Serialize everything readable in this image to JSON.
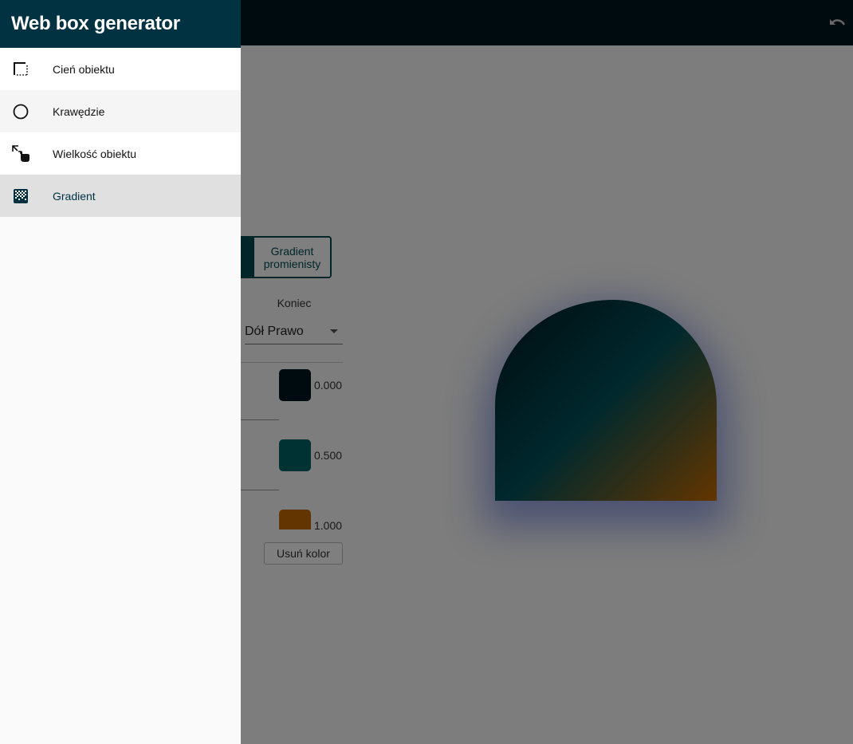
{
  "app": {
    "title": "Web box generator",
    "undo_icon": "undo-icon"
  },
  "nav": {
    "items": [
      {
        "label": "Cień obiektu",
        "icon": "box-shadow-icon",
        "bg": "#ffffff",
        "active": false
      },
      {
        "label": "Krawędzie",
        "icon": "circle-outline-icon",
        "bg": "#f5f5f5",
        "active": false
      },
      {
        "label": "Wielkość obiektu",
        "icon": "resize-pointer-icon",
        "bg": "#ffffff",
        "active": false
      },
      {
        "label": "Gradient",
        "icon": "gradient-icon",
        "bg": "#e0e0e0",
        "active": true
      }
    ]
  },
  "gradient": {
    "type_toggle": {
      "linear_label": "",
      "radial_label": "Gradient promienisty",
      "selected": "linear"
    },
    "end": {
      "label": "Koniec",
      "value": "Dół Prawo"
    },
    "stops": [
      {
        "color": "#00171f",
        "position": "0.000"
      },
      {
        "color": "#006266",
        "position": "0.500"
      },
      {
        "color": "#c76a00",
        "position": "1.000"
      }
    ],
    "remove_color_label": "Usuń kolor"
  },
  "colors": {
    "appbar": "#00171f",
    "drawer_header": "#003242",
    "accent": "#004d55",
    "shadow": "#1e3cc8"
  }
}
